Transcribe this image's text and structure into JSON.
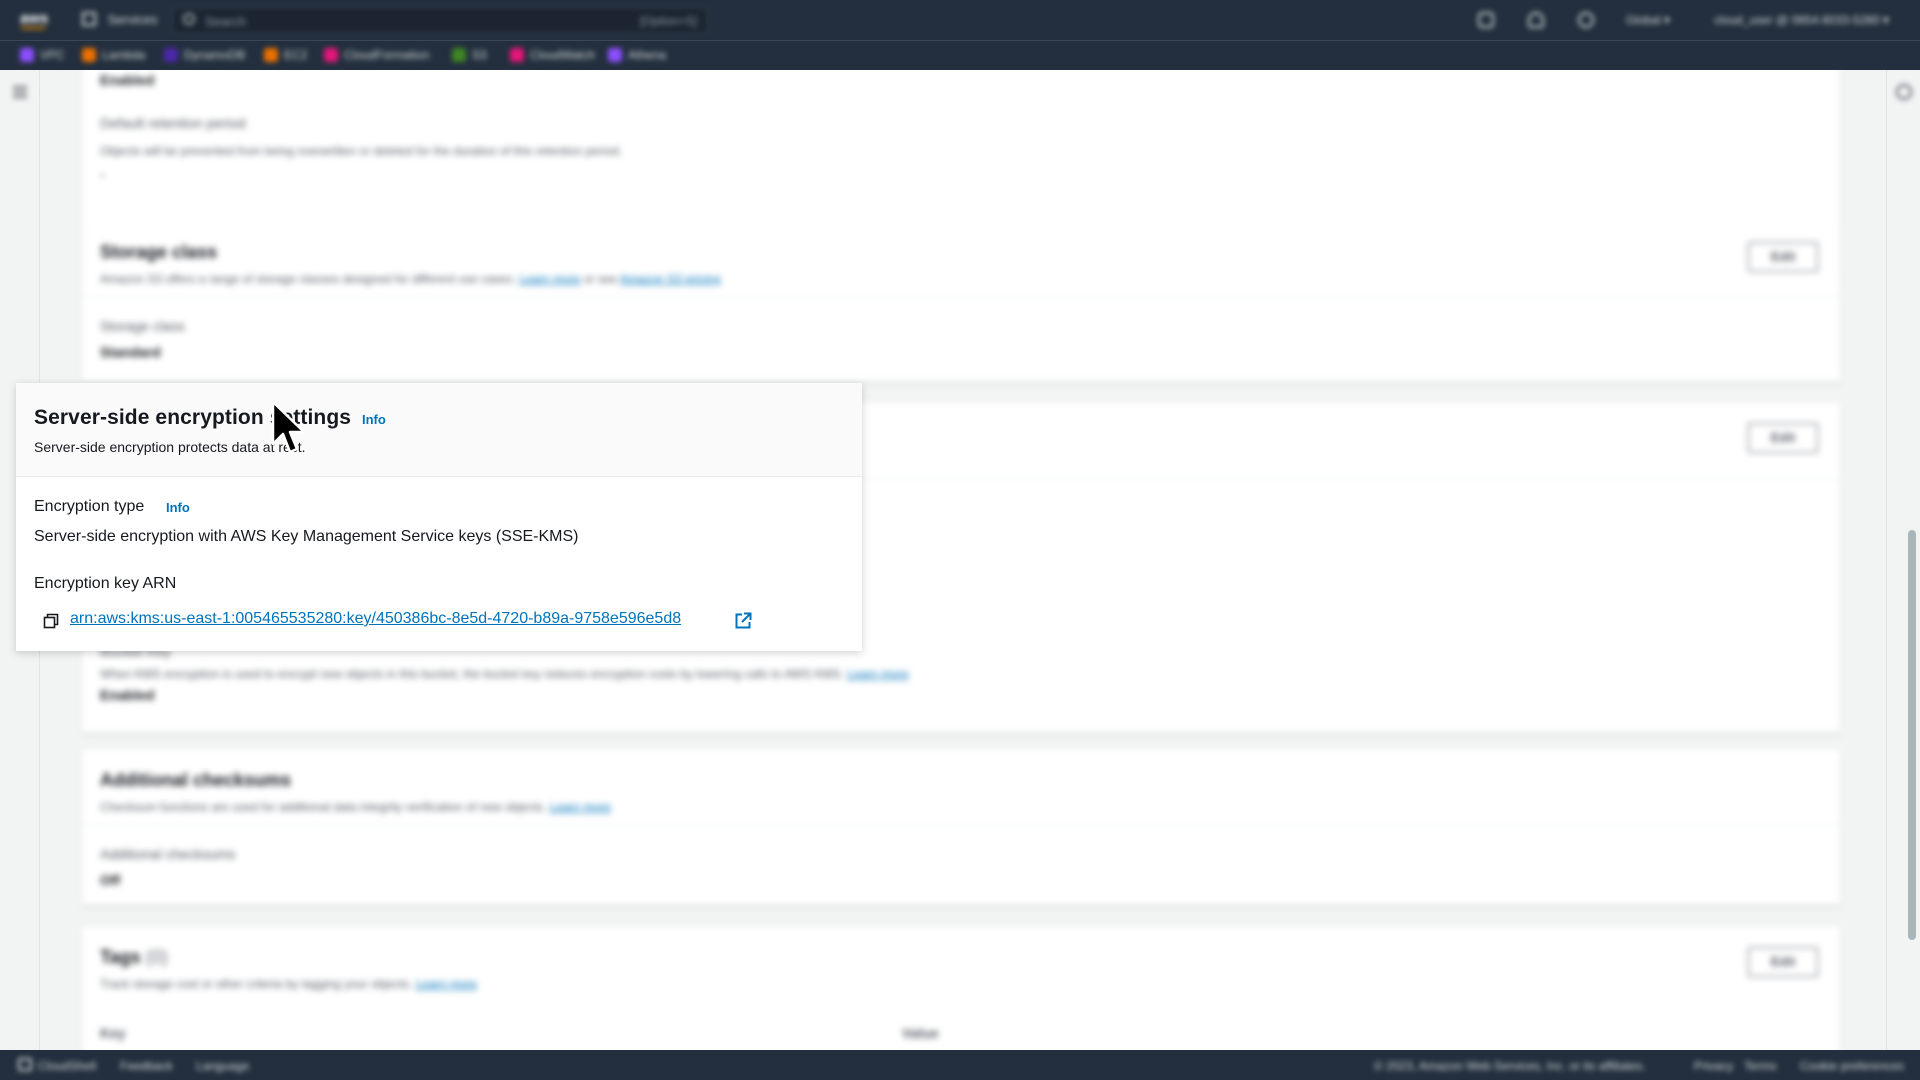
{
  "topnav": {
    "logo": "aws",
    "services_label": "Services",
    "search_placeholder": "Search",
    "search_shortcut": "[Option+S]",
    "region": "Global ▾",
    "account": "cloud_user @ 0654-6033-5280 ▾",
    "icons": [
      "cloudshell-icon",
      "notifications-icon",
      "help-icon"
    ]
  },
  "favorites": [
    {
      "label": "VPC",
      "color": "#8c4fff"
    },
    {
      "label": "Lambda",
      "color": "#ed7100"
    },
    {
      "label": "DynamoDB",
      "color": "#4d27aa"
    },
    {
      "label": "EC2",
      "color": "#ed7100"
    },
    {
      "label": "CloudFormation",
      "color": "#e7157b"
    },
    {
      "label": "S3",
      "color": "#3f8624"
    },
    {
      "label": "CloudWatch",
      "color": "#e7157b"
    },
    {
      "label": "Athena",
      "color": "#8c4fff"
    }
  ],
  "content": {
    "object_lock": {
      "status_value": "Enabled",
      "retention_label": "Default retention period",
      "retention_desc": "Objects will be prevented from being overwritten or deleted for the duration of this retention period.",
      "retention_value": "-"
    },
    "storage_class": {
      "title": "Storage class",
      "desc": "Amazon S3 offers a range of storage classes designed for different use cases.",
      "learn_more": "Learn more",
      "or_see": "or see",
      "pricing_link": "Amazon S3 pricing",
      "edit": "Edit",
      "field_label": "Storage class",
      "field_value": "Standard"
    },
    "encryption_card": {
      "edit": "Edit",
      "bucket_key_label": "Bucket Key",
      "bucket_key_desc": "When KMS encryption is used to encrypt new objects in this bucket, the bucket key reduces encryption costs by lowering calls to AWS KMS.",
      "learn_more": "Learn more",
      "bucket_key_value": "Enabled"
    },
    "checksums": {
      "title": "Additional checksums",
      "desc": "Checksum functions are used for additional data integrity verification of new objects.",
      "learn_more": "Learn more",
      "field_label": "Additional checksums",
      "field_value": "Off"
    },
    "tags": {
      "title": "Tags",
      "count": "(0)",
      "desc": "Track storage cost or other criteria by tagging your objects.",
      "learn_more": "Learn more",
      "edit": "Edit",
      "col_key": "Key",
      "col_value": "Value"
    }
  },
  "popover": {
    "title": "Server-side encryption settings",
    "info": "Info",
    "desc": "Server-side encryption protects data at rest.",
    "encryption_type_label": "Encryption type",
    "encryption_type_value": "Server-side encryption with AWS Key Management Service keys (SSE-KMS)",
    "key_arn_label": "Encryption key ARN",
    "key_arn": "arn:aws:kms:us-east-1:005465535280:key/450386bc-8e5d-4720-b89a-9758e596e5d8"
  },
  "footer": {
    "cloudshell": "CloudShell",
    "feedback": "Feedback",
    "language": "Language",
    "copyright": "© 2023, Amazon Web Services, Inc. or its affiliates.",
    "privacy": "Privacy",
    "terms": "Terms",
    "cookies": "Cookie preferences"
  }
}
